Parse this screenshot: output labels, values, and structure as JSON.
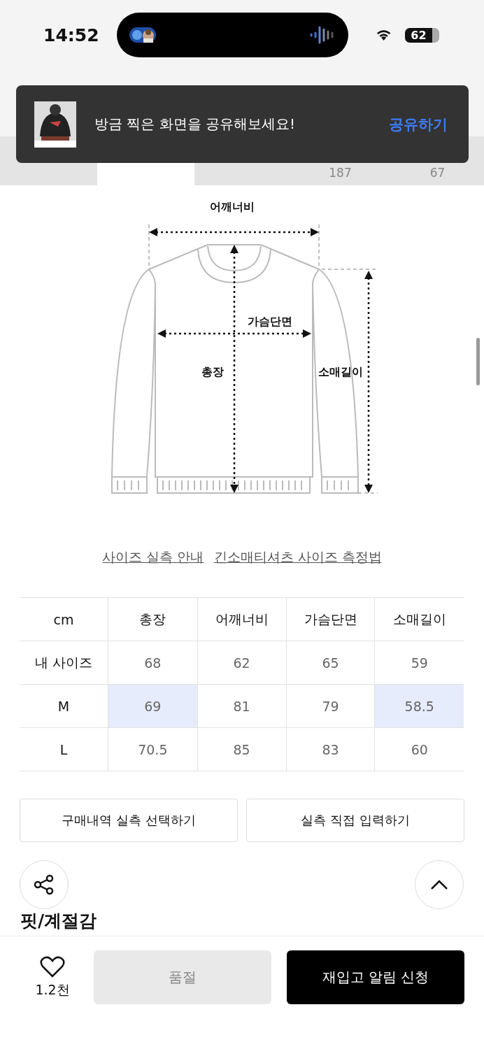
{
  "status_bar": {
    "time": "14:52",
    "battery": "62"
  },
  "tabs": [
    {
      "selected": false
    },
    {
      "selected": true
    },
    {
      "selected": false
    },
    {
      "count": "187",
      "selected": false
    },
    {
      "count": "67",
      "selected": false
    }
  ],
  "toast": {
    "message": "방금 찍은 화면을 공유해보세요!",
    "action": "공유하기"
  },
  "diagram": {
    "labels": {
      "shoulder": "어깨너비",
      "chest": "가슴단면",
      "length": "총장",
      "sleeve": "소매길이"
    }
  },
  "guide_links": [
    "사이즈 실측 안내",
    "긴소매티셔츠 사이즈 측정법"
  ],
  "size_table": {
    "columns": [
      "cm",
      "총장",
      "어깨너비",
      "가슴단면",
      "소매길이"
    ],
    "rows": [
      {
        "cells": [
          {
            "text": "내 사이즈",
            "highlighted": false
          },
          {
            "text": "68",
            "highlighted": false
          },
          {
            "text": "62",
            "highlighted": false
          },
          {
            "text": "65",
            "highlighted": false
          },
          {
            "text": "59",
            "highlighted": false
          }
        ]
      },
      {
        "cells": [
          {
            "text": "M",
            "highlighted": false
          },
          {
            "text": "69",
            "highlighted": true
          },
          {
            "text": "81",
            "highlighted": false
          },
          {
            "text": "79",
            "highlighted": false
          },
          {
            "text": "58.5",
            "highlighted": true
          }
        ]
      },
      {
        "cells": [
          {
            "text": "L",
            "highlighted": false
          },
          {
            "text": "70.5",
            "highlighted": false
          },
          {
            "text": "85",
            "highlighted": false
          },
          {
            "text": "83",
            "highlighted": false
          },
          {
            "text": "60",
            "highlighted": false
          }
        ]
      }
    ]
  },
  "size_buttons": [
    "구매내역 실측 선택하기",
    "실측 직접 입력하기"
  ],
  "section_title": "핏/계절감",
  "bottom_bar": {
    "like_count": "1.2천",
    "sold_out": {
      "label": "품절",
      "disabled": true
    },
    "restock": "재입고 알림 신청"
  }
}
